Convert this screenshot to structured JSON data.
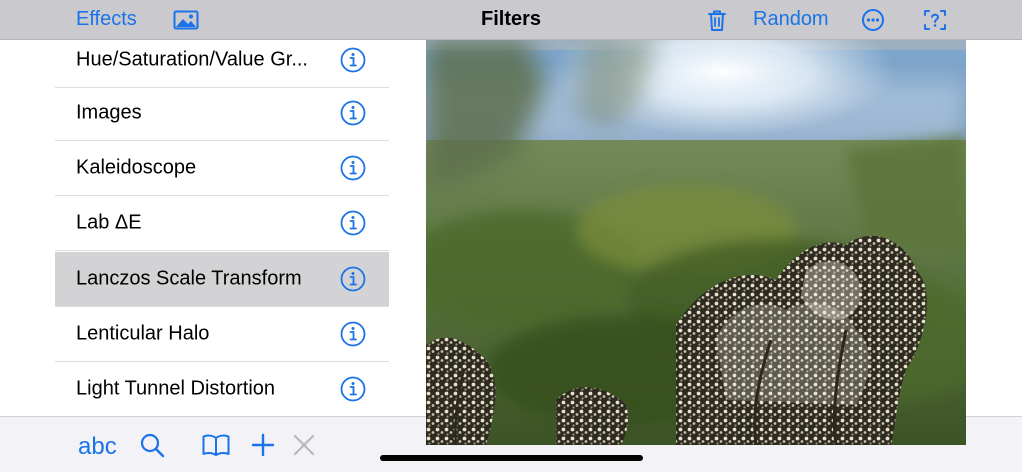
{
  "navbar": {
    "effects_label": "Effects",
    "title": "Filters",
    "random_label": "Random",
    "accent_color": "#1a73e8",
    "icons": [
      "photo-icon",
      "trash-icon",
      "more-icon",
      "help-icon"
    ]
  },
  "filters": {
    "items": [
      {
        "label": "Hue/Saturation/Value Gr..."
      },
      {
        "label": "Images"
      },
      {
        "label": "Kaleidoscope"
      },
      {
        "label": "Lab ΔE"
      },
      {
        "label": "Lanczos Scale Transform"
      },
      {
        "label": "Lenticular Halo"
      },
      {
        "label": "Light Tunnel Distortion"
      }
    ],
    "selected_label": "Lanczos Scale Transform",
    "selected_color": "#d3d3d6"
  },
  "toolbar": {
    "abc_label": "abc",
    "icons": [
      "search-icon",
      "book-icon",
      "plus-icon",
      "close-icon"
    ]
  }
}
